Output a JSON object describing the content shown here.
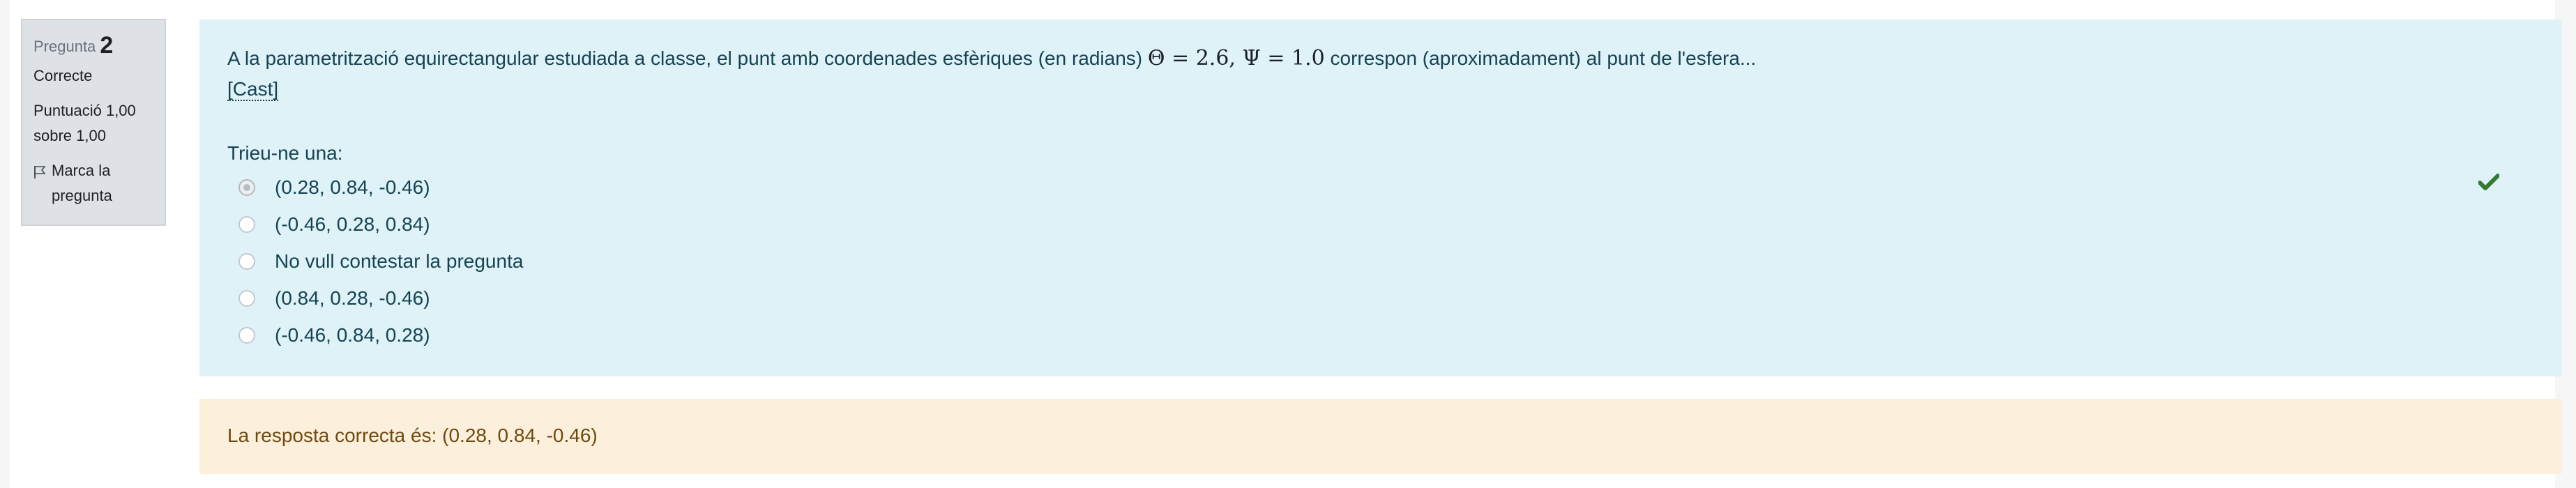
{
  "info": {
    "question_label": "Pregunta",
    "question_number": "2",
    "status": "Correcte",
    "grade_line1": "Puntuació 1,00",
    "grade_line2": "sobre 1,00",
    "flag_line1": "Marca la",
    "flag_line2": "pregunta"
  },
  "question": {
    "text_before": "A la parametrització equirectangular estudiada a classe, el punt amb coordenades esfèriques (en radians) ",
    "math_theta_symbol": "Θ",
    "math_theta_value": " = 2.6, ",
    "math_psi_symbol": "Ψ",
    "math_psi_value": " = 1.0",
    "text_after": " correspon (aproximadament) al punt de l'esfera...",
    "cast_link": "[Cast]",
    "prompt": "Trieu-ne una:"
  },
  "answers": [
    {
      "label": "(0.28, 0.84, -0.46)",
      "selected": true
    },
    {
      "label": "(-0.46, 0.28, 0.84)",
      "selected": false
    },
    {
      "label": "No vull contestar la pregunta",
      "selected": false
    },
    {
      "label": "(0.84, 0.28, -0.46)",
      "selected": false
    },
    {
      "label": "(-0.46, 0.84, 0.28)",
      "selected": false
    }
  ],
  "correct_icon": "check-icon",
  "feedback": {
    "text": "La resposta correcta és: (0.28, 0.84, -0.46)"
  },
  "colors": {
    "question_bg": "#def2f8",
    "feedback_bg": "#fcefdc",
    "info_bg": "#dee2e6",
    "correct": "#357a32"
  }
}
